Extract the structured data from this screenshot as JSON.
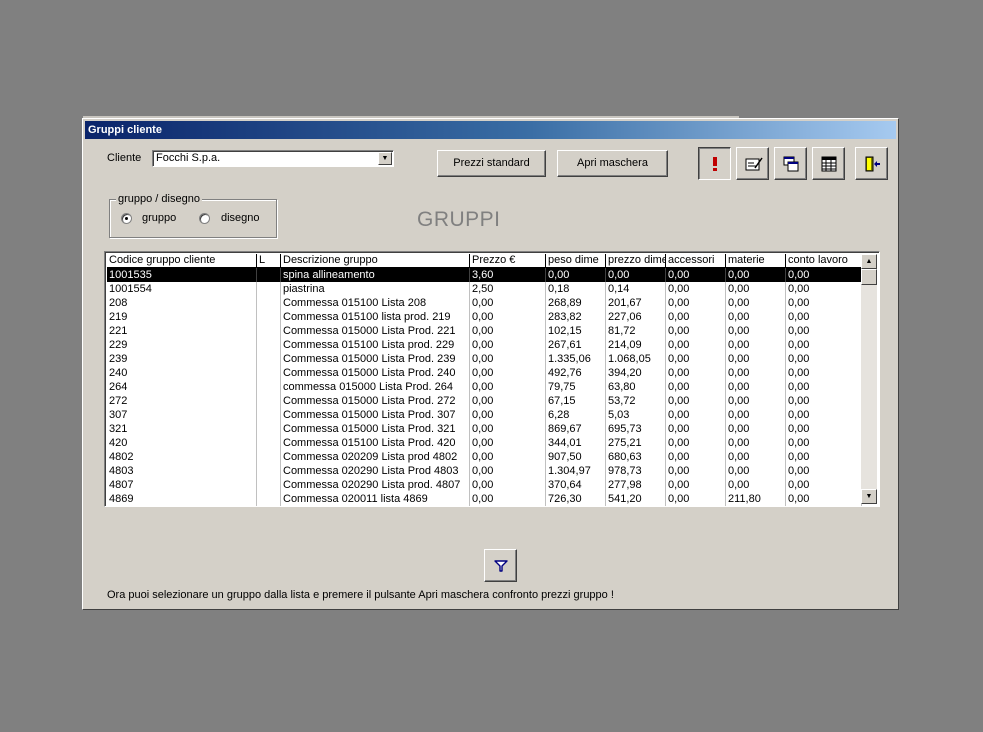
{
  "window": {
    "title": "Gruppi cliente"
  },
  "cliente": {
    "label": "Cliente",
    "value": "Focchi S.p.a."
  },
  "buttons": {
    "prezzi_standard": "Prezzi standard",
    "apri_maschera": "Apri maschera"
  },
  "icons": [
    "warning-icon",
    "edit-form-icon",
    "windows-icon",
    "table-icon",
    "exit-icon",
    "filter-icon"
  ],
  "radio_group": {
    "legend": "gruppo / disegno",
    "options": [
      {
        "label": "gruppo",
        "selected": true
      },
      {
        "label": "disegno",
        "selected": false
      }
    ]
  },
  "section_title": "GRUPPI",
  "table": {
    "columns": [
      "Codice gruppo cliente",
      "L",
      "Descrizione gruppo",
      "Prezzo €",
      "peso dime",
      "prezzo dime",
      "accessori",
      "materie",
      "conto lavoro"
    ],
    "selected_row": 0,
    "rows": [
      [
        "1001535",
        "",
        "spina allineamento",
        "3,60",
        "0,00",
        "0,00",
        "0,00",
        "0,00",
        "0,00"
      ],
      [
        "1001554",
        "",
        "piastrina",
        "2,50",
        "0,18",
        "0,14",
        "0,00",
        "0,00",
        "0,00"
      ],
      [
        "208",
        "",
        "Commessa 015100 Lista 208",
        "0,00",
        "268,89",
        "201,67",
        "0,00",
        "0,00",
        "0,00"
      ],
      [
        "219",
        "",
        "Commessa 015100 lista prod. 219",
        "0,00",
        "283,82",
        "227,06",
        "0,00",
        "0,00",
        "0,00"
      ],
      [
        "221",
        "",
        "Commessa 015000 Lista Prod. 221",
        "0,00",
        "102,15",
        "81,72",
        "0,00",
        "0,00",
        "0,00"
      ],
      [
        "229",
        "",
        "Commessa 015100 Lista prod. 229",
        "0,00",
        "267,61",
        "214,09",
        "0,00",
        "0,00",
        "0,00"
      ],
      [
        "239",
        "",
        "Commessa 015000 Lista Prod. 239",
        "0,00",
        "1.335,06",
        "1.068,05",
        "0,00",
        "0,00",
        "0,00"
      ],
      [
        "240",
        "",
        "Commessa 015000 Lista Prod. 240",
        "0,00",
        "492,76",
        "394,20",
        "0,00",
        "0,00",
        "0,00"
      ],
      [
        "264",
        "",
        "commessa 015000 Lista Prod. 264",
        "0,00",
        "79,75",
        "63,80",
        "0,00",
        "0,00",
        "0,00"
      ],
      [
        "272",
        "",
        "Commessa 015000 Lista Prod. 272",
        "0,00",
        "67,15",
        "53,72",
        "0,00",
        "0,00",
        "0,00"
      ],
      [
        "307",
        "",
        "Commessa 015000 Lista Prod. 307",
        "0,00",
        "6,28",
        "5,03",
        "0,00",
        "0,00",
        "0,00"
      ],
      [
        "321",
        "",
        "Commessa 015000 Lista Prod. 321",
        "0,00",
        "869,67",
        "695,73",
        "0,00",
        "0,00",
        "0,00"
      ],
      [
        "420",
        "",
        "Commessa 015100 Lista Prod. 420",
        "0,00",
        "344,01",
        "275,21",
        "0,00",
        "0,00",
        "0,00"
      ],
      [
        "4802",
        "",
        "Commessa 020209 Lista prod 4802",
        "0,00",
        "907,50",
        "680,63",
        "0,00",
        "0,00",
        "0,00"
      ],
      [
        "4803",
        "",
        "Commessa 020290 Lista Prod 4803",
        "0,00",
        "1.304,97",
        "978,73",
        "0,00",
        "0,00",
        "0,00"
      ],
      [
        "4807",
        "",
        "Commessa 020290 Lista prod. 4807",
        "0,00",
        "370,64",
        "277,98",
        "0,00",
        "0,00",
        "0,00"
      ],
      [
        "4869",
        "",
        "Commessa 020011 lista 4869",
        "0,00",
        "726,30",
        "541,20",
        "0,00",
        "211,80",
        "0,00"
      ]
    ]
  },
  "status_text": "Ora puoi selezionare un gruppo dalla lista e premere il pulsante Apri maschera confronto prezzi gruppo !",
  "colors": {
    "title_start": "#0a246a",
    "title_end": "#a6caf0",
    "face": "#d4d0c8",
    "desktop": "#808080",
    "warning": "#c00000"
  }
}
